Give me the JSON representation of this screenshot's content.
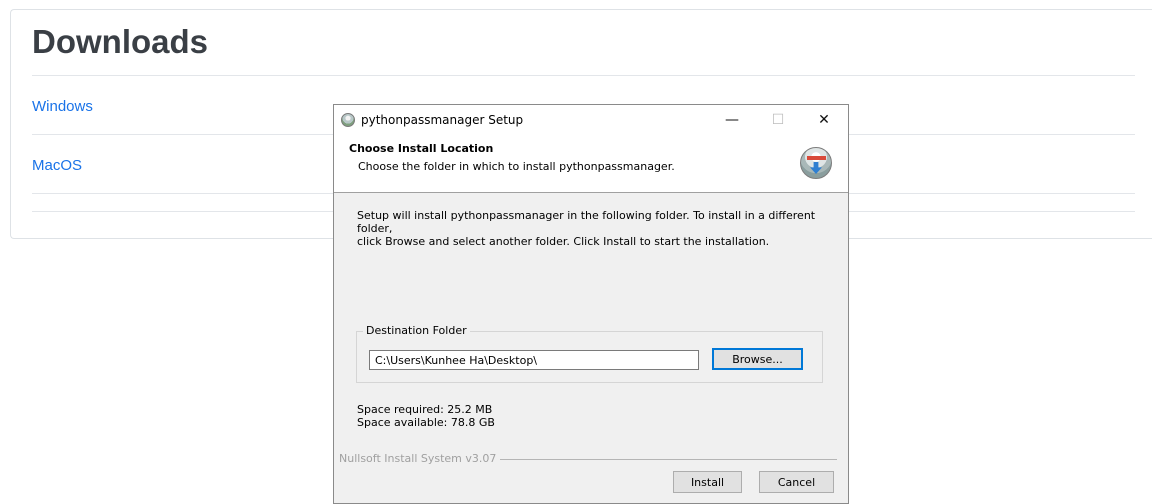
{
  "page": {
    "title": "Downloads",
    "links": [
      {
        "label": "Windows"
      },
      {
        "label": "MacOS"
      }
    ]
  },
  "dialog": {
    "window_title": "pythonpassmanager Setup",
    "controls": {
      "minimize": "—",
      "maximize": "☐",
      "close": "✕"
    },
    "header_title": "Choose Install Location",
    "header_subtitle": "Choose the folder in which to install pythonpassmanager.",
    "body_line1": "Setup will install pythonpassmanager in the following folder. To install in a different folder,",
    "body_line2": "click Browse and select another folder. Click Install to start the installation.",
    "group_label": "Destination Folder",
    "destination_value": "C:\\Users\\Kunhee Ha\\Desktop\\",
    "browse_label": "Browse...",
    "space_required": "Space required: 25.2 MB",
    "space_available": "Space available: 78.8 GB",
    "branding": "Nullsoft Install System v3.07",
    "install_label": "Install",
    "cancel_label": "Cancel",
    "icons": {
      "app": "installer-globe-icon",
      "header": "installer-download-icon"
    }
  },
  "colors": {
    "link": "#1a73e8",
    "title": "#3a3f45",
    "dialog_bg": "#f0f0f0",
    "focus_border": "#0078d7"
  }
}
